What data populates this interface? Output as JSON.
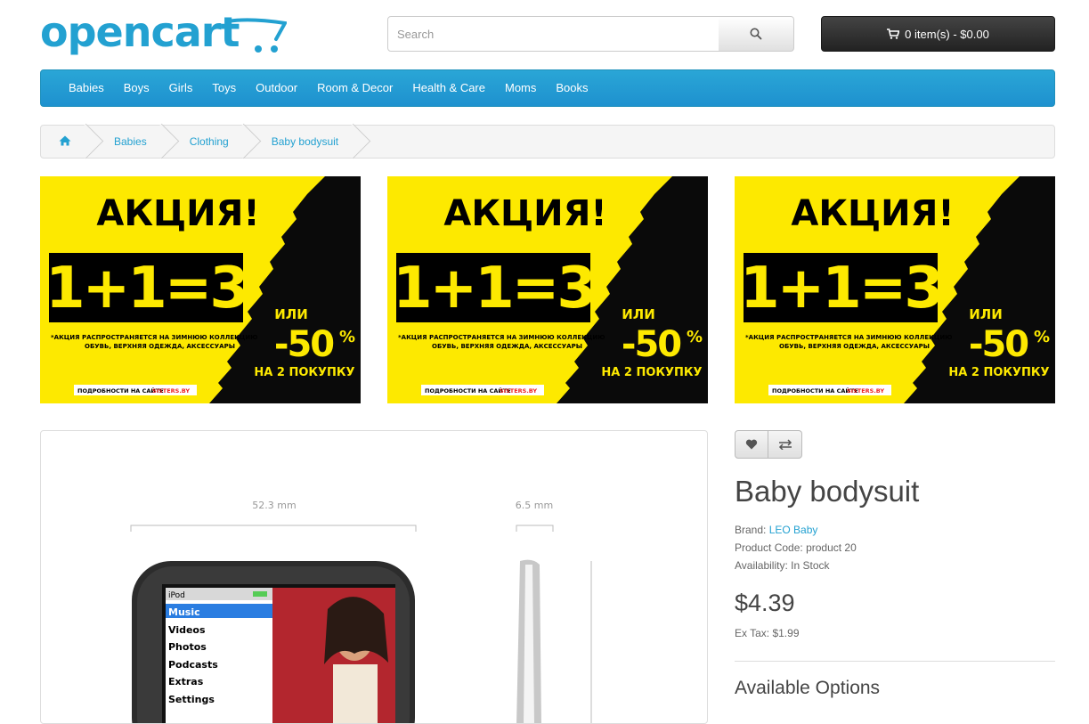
{
  "header": {
    "logo_text": "opencart",
    "search_placeholder": "Search",
    "cart_label": "0 item(s) - $0.00"
  },
  "menu": [
    "Babies",
    "Boys",
    "Girls",
    "Toys",
    "Outdoor",
    "Room & Decor",
    "Health & Care",
    "Moms",
    "Books"
  ],
  "breadcrumb": [
    "Babies",
    "Clothing",
    "Baby bodysuit"
  ],
  "banner": {
    "headline": "АКЦИЯ!",
    "formula": "1+1=3",
    "or": "ИЛИ",
    "discount": "-50",
    "percent": "%",
    "second": "НА 2 ПОКУПКУ",
    "note1": "*АКЦИЯ РАСПРОСТРАНЯЕТСЯ НА ЗИМНЮЮ КОЛЛЕКЦИЮ",
    "note2": "ОБУВЬ, ВЕРХНЯЯ ОДЕЖДА, АКСЕССУАРЫ",
    "details": "ПОДРОБНОСТИ НА САЙТЕ",
    "site": "SISTERS.BY"
  },
  "image": {
    "width_label": "52.3 mm",
    "depth_label": "6.5 mm",
    "ipod_title": "iPod",
    "ipod_menu": [
      "Music",
      "Videos",
      "Photos",
      "Podcasts",
      "Extras",
      "Settings"
    ]
  },
  "product": {
    "title": "Baby bodysuit",
    "brand_label": "Brand:",
    "brand": "LEO Baby",
    "code_label": "Product Code:",
    "code": "product 20",
    "availability_label": "Availability:",
    "availability": "In Stock",
    "price": "$4.39",
    "ex_tax": "Ex Tax: $1.99",
    "options_heading": "Available Options"
  },
  "colors": {
    "accent": "#23a1d1",
    "banner_yellow": "#fde900",
    "cart_dark": "#2b2b2b"
  }
}
